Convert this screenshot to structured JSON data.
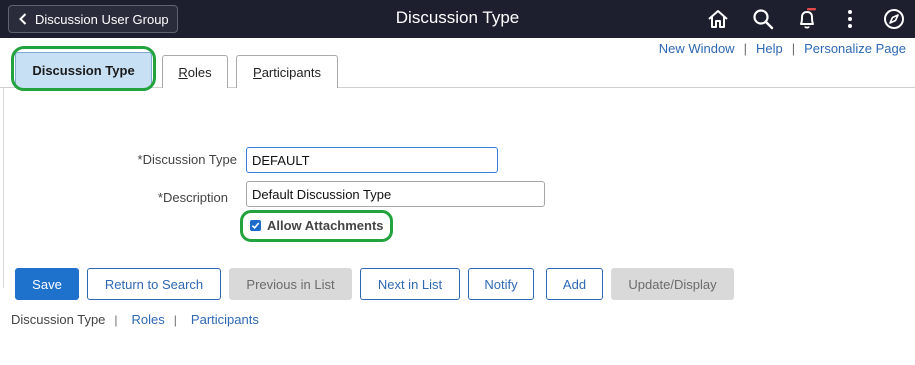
{
  "banner": {
    "back_label": "Discussion User Group",
    "title": "Discussion Type",
    "icons": [
      "home-icon",
      "search-icon",
      "bell-icon",
      "more-icon",
      "compass-icon"
    ]
  },
  "top_links": {
    "new_window": "New Window",
    "help": "Help",
    "personalize": "Personalize Page",
    "separator": "|"
  },
  "tabs": [
    {
      "label": "Discussion Type",
      "active": true
    },
    {
      "label": "Roles",
      "first": "R",
      "rest": "oles"
    },
    {
      "label": "Participants",
      "first": "P",
      "rest": "articipants"
    }
  ],
  "form": {
    "type_label": "*Discussion Type",
    "type_value": "DEFAULT",
    "desc_label": "*Description",
    "desc_value": "Default Discussion Type",
    "allow_attachments_label": "Allow Attachments",
    "allow_attachments_checked": true
  },
  "buttons": {
    "save": "Save",
    "return_to_search": "Return to Search",
    "previous_in_list": "Previous in List",
    "next_in_list": "Next in List",
    "notify": "Notify",
    "add": "Add",
    "update_display": "Update/Display"
  },
  "bottom_links": {
    "current": "Discussion Type",
    "roles": "Roles",
    "participants": "Participants",
    "separator": "|"
  },
  "colors": {
    "banner_bg": "#1d1f2e",
    "accent_blue": "#1f72cc",
    "link_blue": "#2e68b3",
    "active_tab_bg": "#c7e0f4",
    "highlight_green": "#22a33d",
    "disabled_bg": "#d9d9d9"
  }
}
